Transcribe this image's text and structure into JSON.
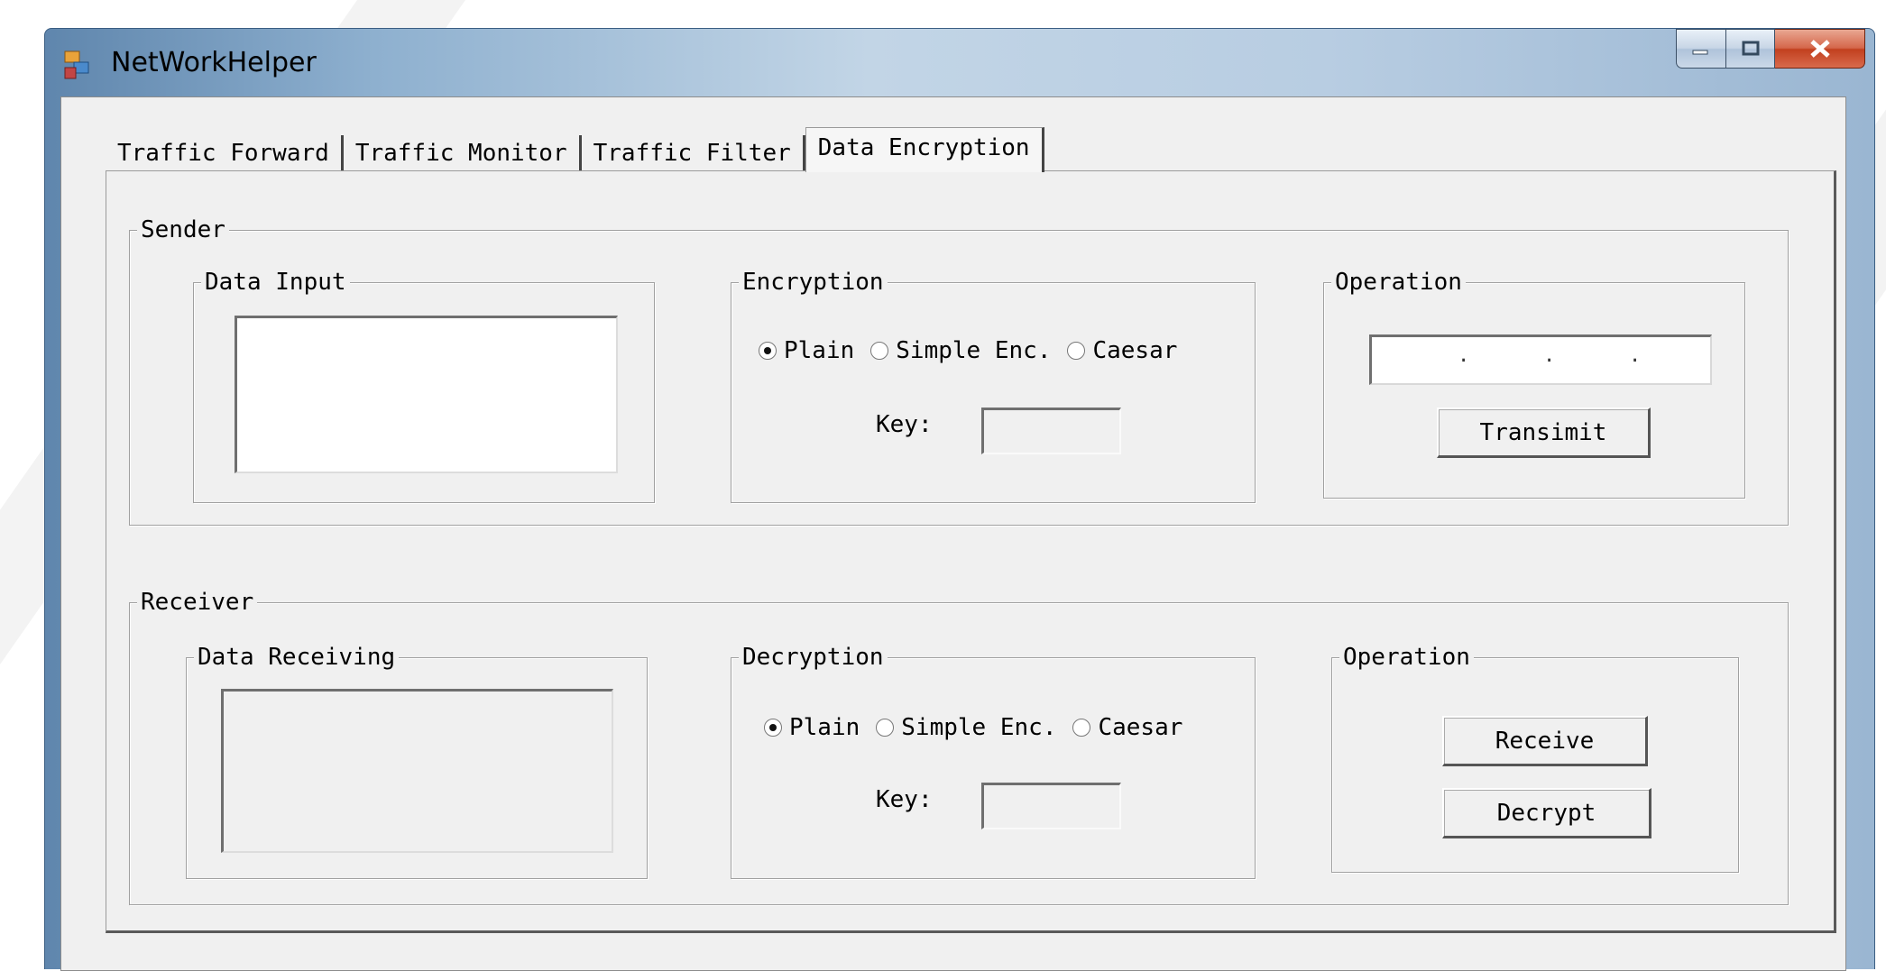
{
  "window": {
    "title": "NetWorkHelper",
    "icon": "network-app-icon",
    "controls": {
      "minimize": "minimize-icon",
      "maximize": "maximize-icon",
      "close": "close-icon"
    }
  },
  "tabs": [
    {
      "label": "Traffic Forward",
      "active": false
    },
    {
      "label": "Traffic Monitor",
      "active": false
    },
    {
      "label": "Traffic Filter",
      "active": false
    },
    {
      "label": "Data Encryption",
      "active": true
    }
  ],
  "sender": {
    "title": "Sender",
    "data_input": {
      "title": "Data Input",
      "value": ""
    },
    "encryption": {
      "title": "Encryption",
      "options": [
        "Plain",
        "Simple Enc.",
        "Caesar"
      ],
      "selected": "Plain",
      "key_label": "Key:",
      "key_value": ""
    },
    "operation": {
      "title": "Operation",
      "ip_dots": [
        ".",
        ".",
        "."
      ],
      "transmit_label": "Transimit"
    }
  },
  "receiver": {
    "title": "Receiver",
    "data_receiving": {
      "title": "Data Receiving",
      "value": ""
    },
    "decryption": {
      "title": "Decryption",
      "options": [
        "Plain",
        "Simple Enc.",
        "Caesar"
      ],
      "selected": "Plain",
      "key_label": "Key:",
      "key_value": ""
    },
    "operation": {
      "title": "Operation",
      "receive_label": "Receive",
      "decrypt_label": "Decrypt"
    }
  }
}
